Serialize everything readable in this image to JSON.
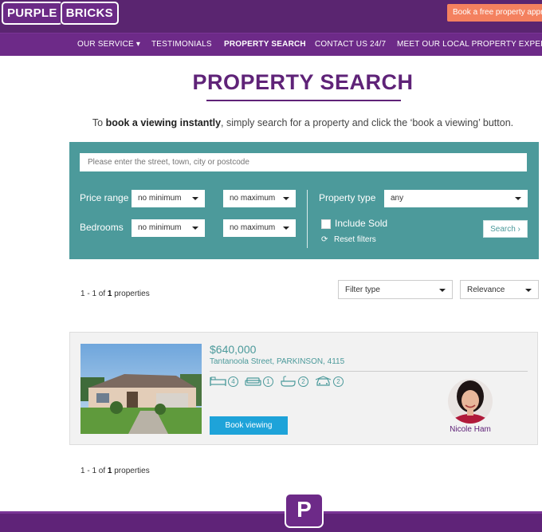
{
  "header": {
    "logo_left": "PURPLE",
    "logo_right": "BRICKS",
    "cta": "Book a free property appr"
  },
  "nav": {
    "items": [
      {
        "label": "OUR SERVICE ▾"
      },
      {
        "label": "TESTIMONIALS"
      },
      {
        "label": "PROPERTY SEARCH"
      },
      {
        "label": "CONTACT US 24/7"
      },
      {
        "label": "MEET OUR LOCAL PROPERTY EXPERTS"
      }
    ]
  },
  "page": {
    "title": "PROPERTY SEARCH",
    "intro_pre": "To ",
    "intro_bold": "book a viewing instantly",
    "intro_post": ", simply search for a property and click the ‘book a viewing’ button."
  },
  "search": {
    "placeholder": "Please enter the street, town, city or postcode",
    "price_label": "Price range",
    "bedrooms_label": "Bedrooms",
    "price_min": "no minimum",
    "price_max": "no maximum",
    "bed_min": "no minimum",
    "bed_max": "no maximum",
    "type_label": "Property type",
    "type_value": "any",
    "include_sold": "Include Sold",
    "reset": "Reset filters",
    "search_button": "Search  ›"
  },
  "results": {
    "count_pre": "1 - 1 of ",
    "count_bold": "1",
    "count_post": " properties",
    "filter_type": "Filter type",
    "sort": "Relevance"
  },
  "listing": {
    "price": "$640,000",
    "address": "Tantanoola Street, PARKINSON, 4115",
    "bedrooms": "4",
    "living": "1",
    "bathrooms": "2",
    "parking": "2",
    "book_button": "Book viewing",
    "agent_name": "Nicole Ham"
  },
  "footer": {
    "logo": "P"
  },
  "colors": {
    "brand_purple": "#5f2378",
    "teal": "#4c9a9b",
    "cta_orange": "#f4815f",
    "book_blue": "#1ea3d9"
  }
}
